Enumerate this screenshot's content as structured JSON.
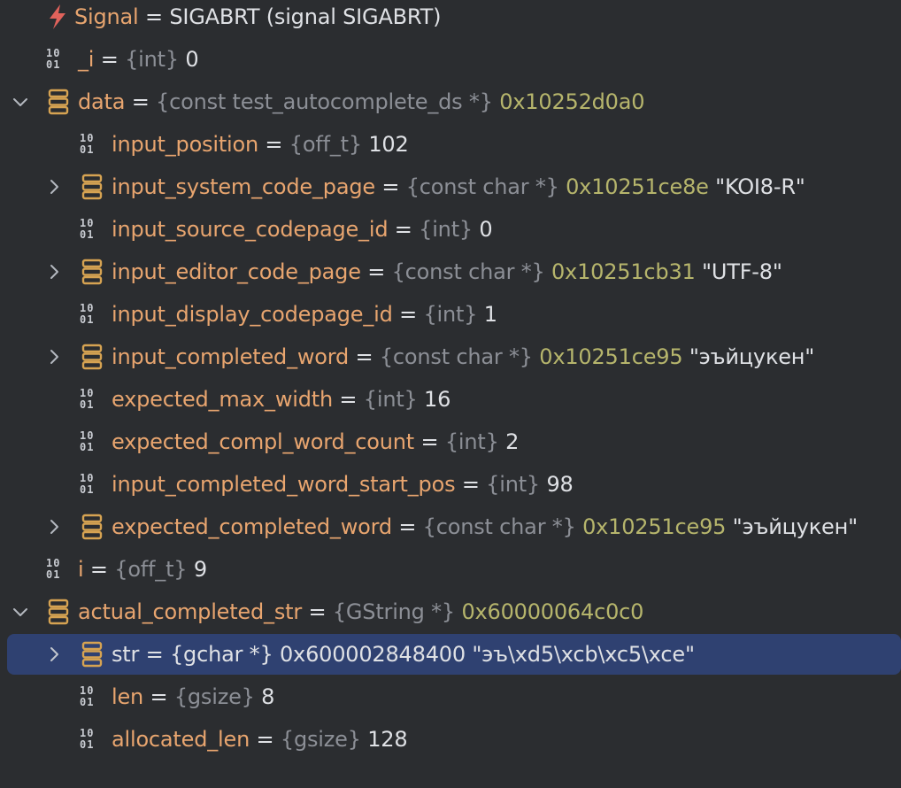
{
  "rows": [
    {
      "name": "Signal",
      "eq": " = ",
      "type": "",
      "addr": "",
      "value": "SIGABRT (signal SIGABRT)"
    },
    {
      "name": "_i",
      "eq": " = ",
      "type": "{int}",
      "addr": "",
      "value": " 0"
    },
    {
      "name": "data",
      "eq": " = ",
      "type": "{const test_autocomplete_ds *}",
      "addr": " 0x10252d0a0",
      "value": ""
    },
    {
      "name": "input_position",
      "eq": " = ",
      "type": "{off_t}",
      "addr": "",
      "value": " 102"
    },
    {
      "name": "input_system_code_page",
      "eq": " = ",
      "type": "{const char *}",
      "addr": " 0x10251ce8e",
      "value": " \"KOI8-R\""
    },
    {
      "name": "input_source_codepage_id",
      "eq": " = ",
      "type": "{int}",
      "addr": "",
      "value": " 0"
    },
    {
      "name": "input_editor_code_page",
      "eq": " = ",
      "type": "{const char *}",
      "addr": " 0x10251cb31",
      "value": " \"UTF-8\""
    },
    {
      "name": "input_display_codepage_id",
      "eq": " = ",
      "type": "{int}",
      "addr": "",
      "value": " 1"
    },
    {
      "name": "input_completed_word",
      "eq": " = ",
      "type": "{const char *}",
      "addr": " 0x10251ce95",
      "value": " \"эъйцукен\""
    },
    {
      "name": "expected_max_width",
      "eq": " = ",
      "type": "{int}",
      "addr": "",
      "value": " 16"
    },
    {
      "name": "expected_compl_word_count",
      "eq": " = ",
      "type": "{int}",
      "addr": "",
      "value": " 2"
    },
    {
      "name": "input_completed_word_start_pos",
      "eq": " = ",
      "type": "{int}",
      "addr": "",
      "value": " 98"
    },
    {
      "name": "expected_completed_word",
      "eq": " = ",
      "type": "{const char *}",
      "addr": " 0x10251ce95",
      "value": " \"эъйцукен\""
    },
    {
      "name": "i",
      "eq": " = ",
      "type": "{off_t}",
      "addr": "",
      "value": " 9"
    },
    {
      "name": "actual_completed_str",
      "eq": " = ",
      "type": "{GString *}",
      "addr": " 0x60000064c0c0",
      "value": ""
    },
    {
      "name": "str",
      "eq": " = ",
      "type": "{gchar *}",
      "addr": " 0x600002848400",
      "value": " \"эъ\\xd5\\xcb\\xc5\\xce\""
    },
    {
      "name": "len",
      "eq": " = ",
      "type": "{gsize}",
      "addr": "",
      "value": " 8"
    },
    {
      "name": "allocated_len",
      "eq": " = ",
      "type": "{gsize}",
      "addr": "",
      "value": " 128"
    }
  ],
  "icons": {
    "binary_top": "10",
    "binary_bottom": "01"
  },
  "colors": {
    "background": "#2b2d30",
    "selection": "#2f4171",
    "name": "#e8a56f",
    "type": "#8c8f96",
    "address": "#b6b56c",
    "text": "#dfe1e5",
    "signal": "#e0625b"
  }
}
